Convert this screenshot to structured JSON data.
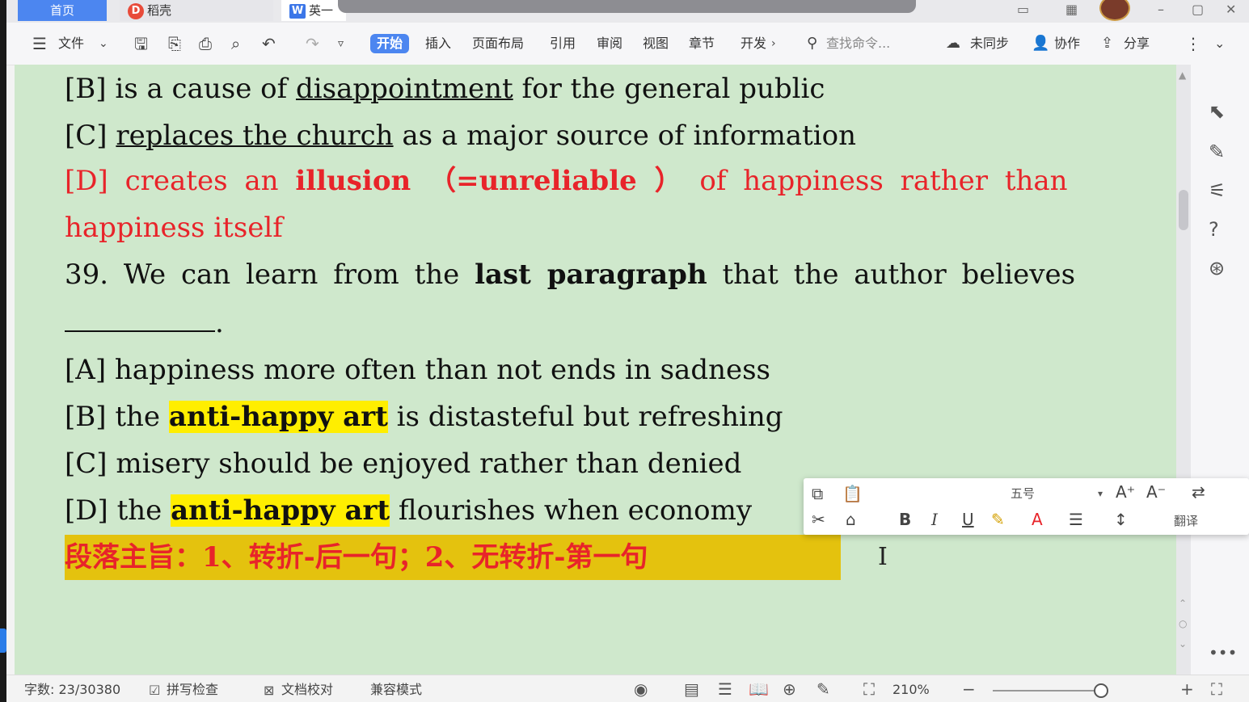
{
  "titlebar": {
    "tab_home": "首页",
    "tab_daoke": "稻壳",
    "tab_doc": "英一"
  },
  "ribbon": {
    "menu_label": "文件",
    "tabs": [
      "开始",
      "插入",
      "页面布局",
      "引用",
      "审阅",
      "视图",
      "章节",
      "开发"
    ],
    "active_tab": "开始",
    "search_placeholder": "查找命令...",
    "sync": "未同步",
    "collab": "协作",
    "share": "分享"
  },
  "document": {
    "line_b_prefix": "[B] is a cause of ",
    "line_b_underlined": "disappointment",
    "line_b_suffix": " for the general public",
    "line_c_prefix": "[C] ",
    "line_c_underlined": "replaces the church",
    "line_c_suffix": " as a major source of information",
    "line_d_1": "[D] creates an ",
    "line_d_bold1": "illusion",
    "line_d_paren": " （=unreliable ） ",
    "line_d_2": " of happiness rather than",
    "line_d_cont": "happiness itself",
    "q39_prefix": "39.  We can learn from the ",
    "q39_bold": "last paragraph",
    "q39_suffix": " that the author believes",
    "q39_blank_end": ".",
    "opt_a": "[A] happiness more often than not ends in sadness",
    "opt_b_prefix": "[B] the ",
    "opt_b_hl": "anti-happy art",
    "opt_b_suffix": " is distasteful but refreshing",
    "opt_c": "[C] misery should be enjoyed rather than denied",
    "opt_d_prefix": "[D] the ",
    "opt_d_hl": "anti-happy art",
    "opt_d_suffix": " flourishes when economy",
    "summary": "段落主旨：1、转折-后一句；2、无转折-第一句"
  },
  "mini_toolbar": {
    "font_size": "五号",
    "translate": "翻译"
  },
  "status_bar": {
    "word_count": "字数: 23/30380",
    "spell_check": "拼写检查",
    "doc_proof": "文档校对",
    "compat_mode": "兼容模式",
    "zoom": "210%"
  },
  "colors": {
    "doc_background": "#cfe8cc",
    "highlight_yellow": "#ffee00",
    "red_text": "#e8242a",
    "summary_bg": "#e4c20e",
    "accent_blue": "#4c86f0"
  }
}
